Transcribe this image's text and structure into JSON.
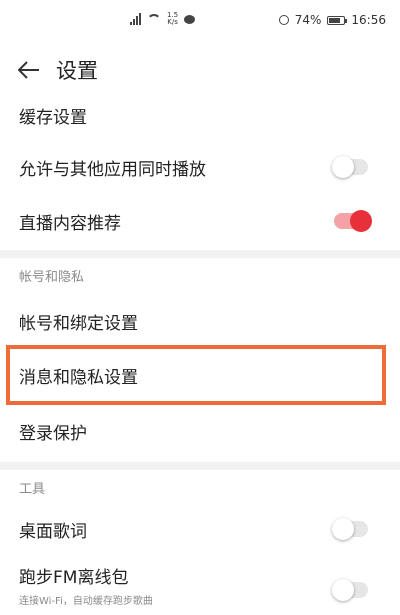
{
  "status": {
    "net_speed": "1.5\nK/s",
    "battery": "74%",
    "battery_level": 0.74,
    "time": "16:56"
  },
  "header": {
    "back_icon": "arrow-left-icon",
    "title": "设置"
  },
  "items": {
    "cache": "缓存设置",
    "allow_play": {
      "label": "允许与其他应用同时播放",
      "on": false
    },
    "live_recommend": {
      "label": "直播内容推荐",
      "on": true
    }
  },
  "account_section": {
    "label": "帐号和隐私",
    "bind": "帐号和绑定设置",
    "privacy": "消息和隐私设置",
    "login_protect": "登录保护"
  },
  "tools_section": {
    "label": "工具",
    "desktop_lyrics": {
      "label": "桌面歌词",
      "on": false
    },
    "running_fm": {
      "label": "跑步FM离线包",
      "subtitle": "连接Wi-Fi，自动缓存跑步歌曲",
      "on": false
    }
  },
  "colors": {
    "accent": "#e8303a",
    "highlight": "#ee6c3a"
  }
}
